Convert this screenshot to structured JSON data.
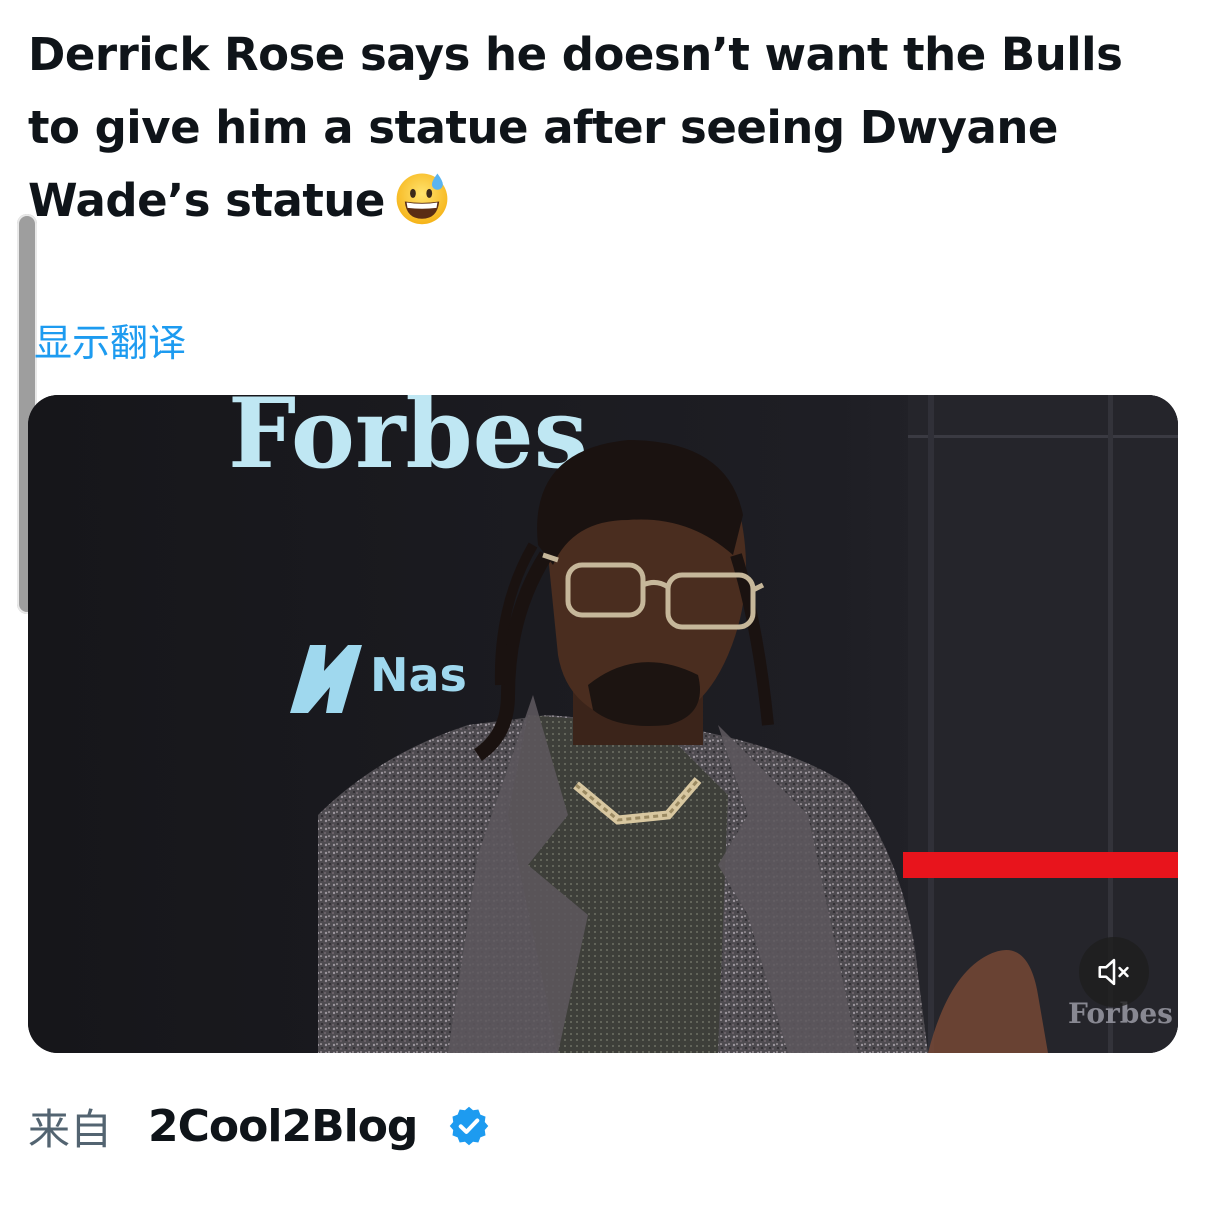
{
  "tweet": {
    "text": "Derrick Rose says he doesn’t want the Bulls to give him a statue after seeing Dwyane Wade’s statue",
    "emoji": "grinning-face-with-sweat"
  },
  "translate": {
    "label": "显示翻译"
  },
  "media": {
    "type": "video",
    "muted": true,
    "backdrop_logo_text": "Forbes",
    "sponsor_text": "Nas",
    "watermark_text": "Forbes",
    "mute_icon": "speaker-muted-icon"
  },
  "attribution": {
    "from_label": "来自",
    "author": "2Cool2Blog",
    "verified": true,
    "badge_icon": "verified-badge-icon"
  },
  "colors": {
    "text": "#0f1419",
    "link": "#1d9bf0",
    "secondary": "#536471",
    "verified": "#1d9bf0"
  }
}
